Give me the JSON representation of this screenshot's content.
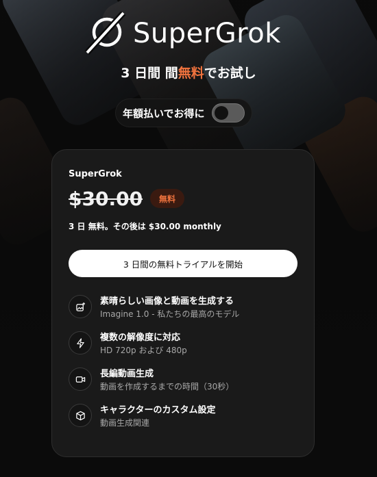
{
  "brand": {
    "name": "SuperGrok"
  },
  "trial_title": {
    "prefix": "3 日間 間",
    "highlight": "無料",
    "suffix": "でお試し"
  },
  "annual_toggle": {
    "label": "年額払いでお得に",
    "enabled": false
  },
  "plan": {
    "name": "SuperGrok",
    "price": "$30.00",
    "badge": "無料",
    "after_trial": "3 日 無料。その後は $30.00 monthly",
    "cta_label": "3 日間の無料トライアルを開始"
  },
  "features": [
    {
      "icon": "image-sparkle-icon",
      "title": "素晴らしい画像と動画を生成する",
      "desc": "Imagine 1.0 - 私たちの最高のモデル"
    },
    {
      "icon": "lightning-icon",
      "title": "複数の解像度に対応",
      "desc": "HD 720p および 480p"
    },
    {
      "icon": "video-camera-icon",
      "title": "長編動画生成",
      "desc": "動画を作成するまでの時間（30秒）"
    },
    {
      "icon": "cube-icon",
      "title": "キャラクターのカスタム設定",
      "desc": "動画生成関連"
    }
  ],
  "colors": {
    "accent": "#f0733e",
    "background": "#0b0b0b",
    "card": "#1a1a1a"
  }
}
